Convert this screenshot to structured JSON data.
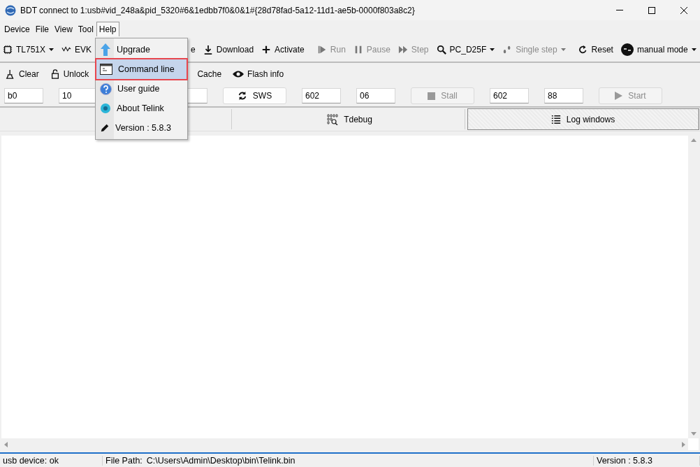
{
  "window": {
    "title": "BDT connect to 1:usb#vid_248a&pid_5320#6&1edbb7f0&0&1#{28d78fad-5a12-11d1-ae5b-0000f803a8c2}"
  },
  "menubar": [
    {
      "label": "Device",
      "selected": false
    },
    {
      "label": "File",
      "selected": false
    },
    {
      "label": "View",
      "selected": false
    },
    {
      "label": "Tool",
      "selected": false
    },
    {
      "label": "Help",
      "selected": true
    }
  ],
  "help_menu": [
    {
      "label": "Upgrade",
      "selected": false
    },
    {
      "label": "Command line",
      "selected": true
    },
    {
      "label": "User guide",
      "selected": false
    },
    {
      "label": "About Telink",
      "selected": false
    },
    {
      "label": "Version : 5.8.3",
      "selected": false
    }
  ],
  "toolbar": [
    {
      "kind": "dropdown",
      "label": "TL751X",
      "disabled": false
    },
    {
      "kind": "dropdown",
      "label": "EVK",
      "disabled": false
    },
    {
      "kind": "hidden"
    },
    {
      "kind": "button",
      "label": "e",
      "disabled": false
    },
    {
      "kind": "button",
      "label": "Download",
      "disabled": false
    },
    {
      "kind": "button",
      "label": "Activate",
      "disabled": false
    },
    {
      "kind": "separator"
    },
    {
      "kind": "button",
      "label": "Run",
      "disabled": true
    },
    {
      "kind": "button",
      "label": "Pause",
      "disabled": true
    },
    {
      "kind": "button",
      "label": "Step",
      "disabled": true
    },
    {
      "kind": "dropdown",
      "label": "PC_D25F",
      "disabled": false
    },
    {
      "kind": "dropdown",
      "label": "Single step",
      "disabled": true
    },
    {
      "kind": "separator"
    },
    {
      "kind": "button",
      "label": "Reset",
      "disabled": false
    },
    {
      "kind": "dropdown",
      "label": "manual mode",
      "disabled": false
    },
    {
      "kind": "separator"
    }
  ],
  "toolbar2": [
    {
      "kind": "button",
      "label": "Clear"
    },
    {
      "kind": "button",
      "label": "Unlock"
    },
    {
      "kind": "hidden"
    },
    {
      "kind": "button",
      "label": "Cache"
    },
    {
      "kind": "button",
      "label": "Flash info"
    }
  ],
  "controls": [
    {
      "kind": "field",
      "value": "b0"
    },
    {
      "kind": "field",
      "value": "10"
    },
    {
      "kind": "covered_field"
    },
    {
      "kind": "button",
      "label": "SWS",
      "disabled": false
    },
    {
      "kind": "field",
      "value": "602"
    },
    {
      "kind": "field",
      "value": "06"
    },
    {
      "kind": "button",
      "label": "Stall",
      "disabled": true
    },
    {
      "kind": "field",
      "value": "602"
    },
    {
      "kind": "field",
      "value": "88"
    },
    {
      "kind": "button",
      "label": "Start",
      "disabled": true
    }
  ],
  "tabs": [
    {
      "selected": false
    },
    {
      "label": "Tdebug",
      "selected": false
    },
    {
      "label": "Log windows",
      "selected": true
    }
  ],
  "status_bar": {
    "device": "usb device: ok",
    "file_label": "File Path:",
    "file_path": "C:\\Users\\Admin\\Desktop\\bin\\Telink.bin",
    "version": "Version : 5.8.3"
  }
}
